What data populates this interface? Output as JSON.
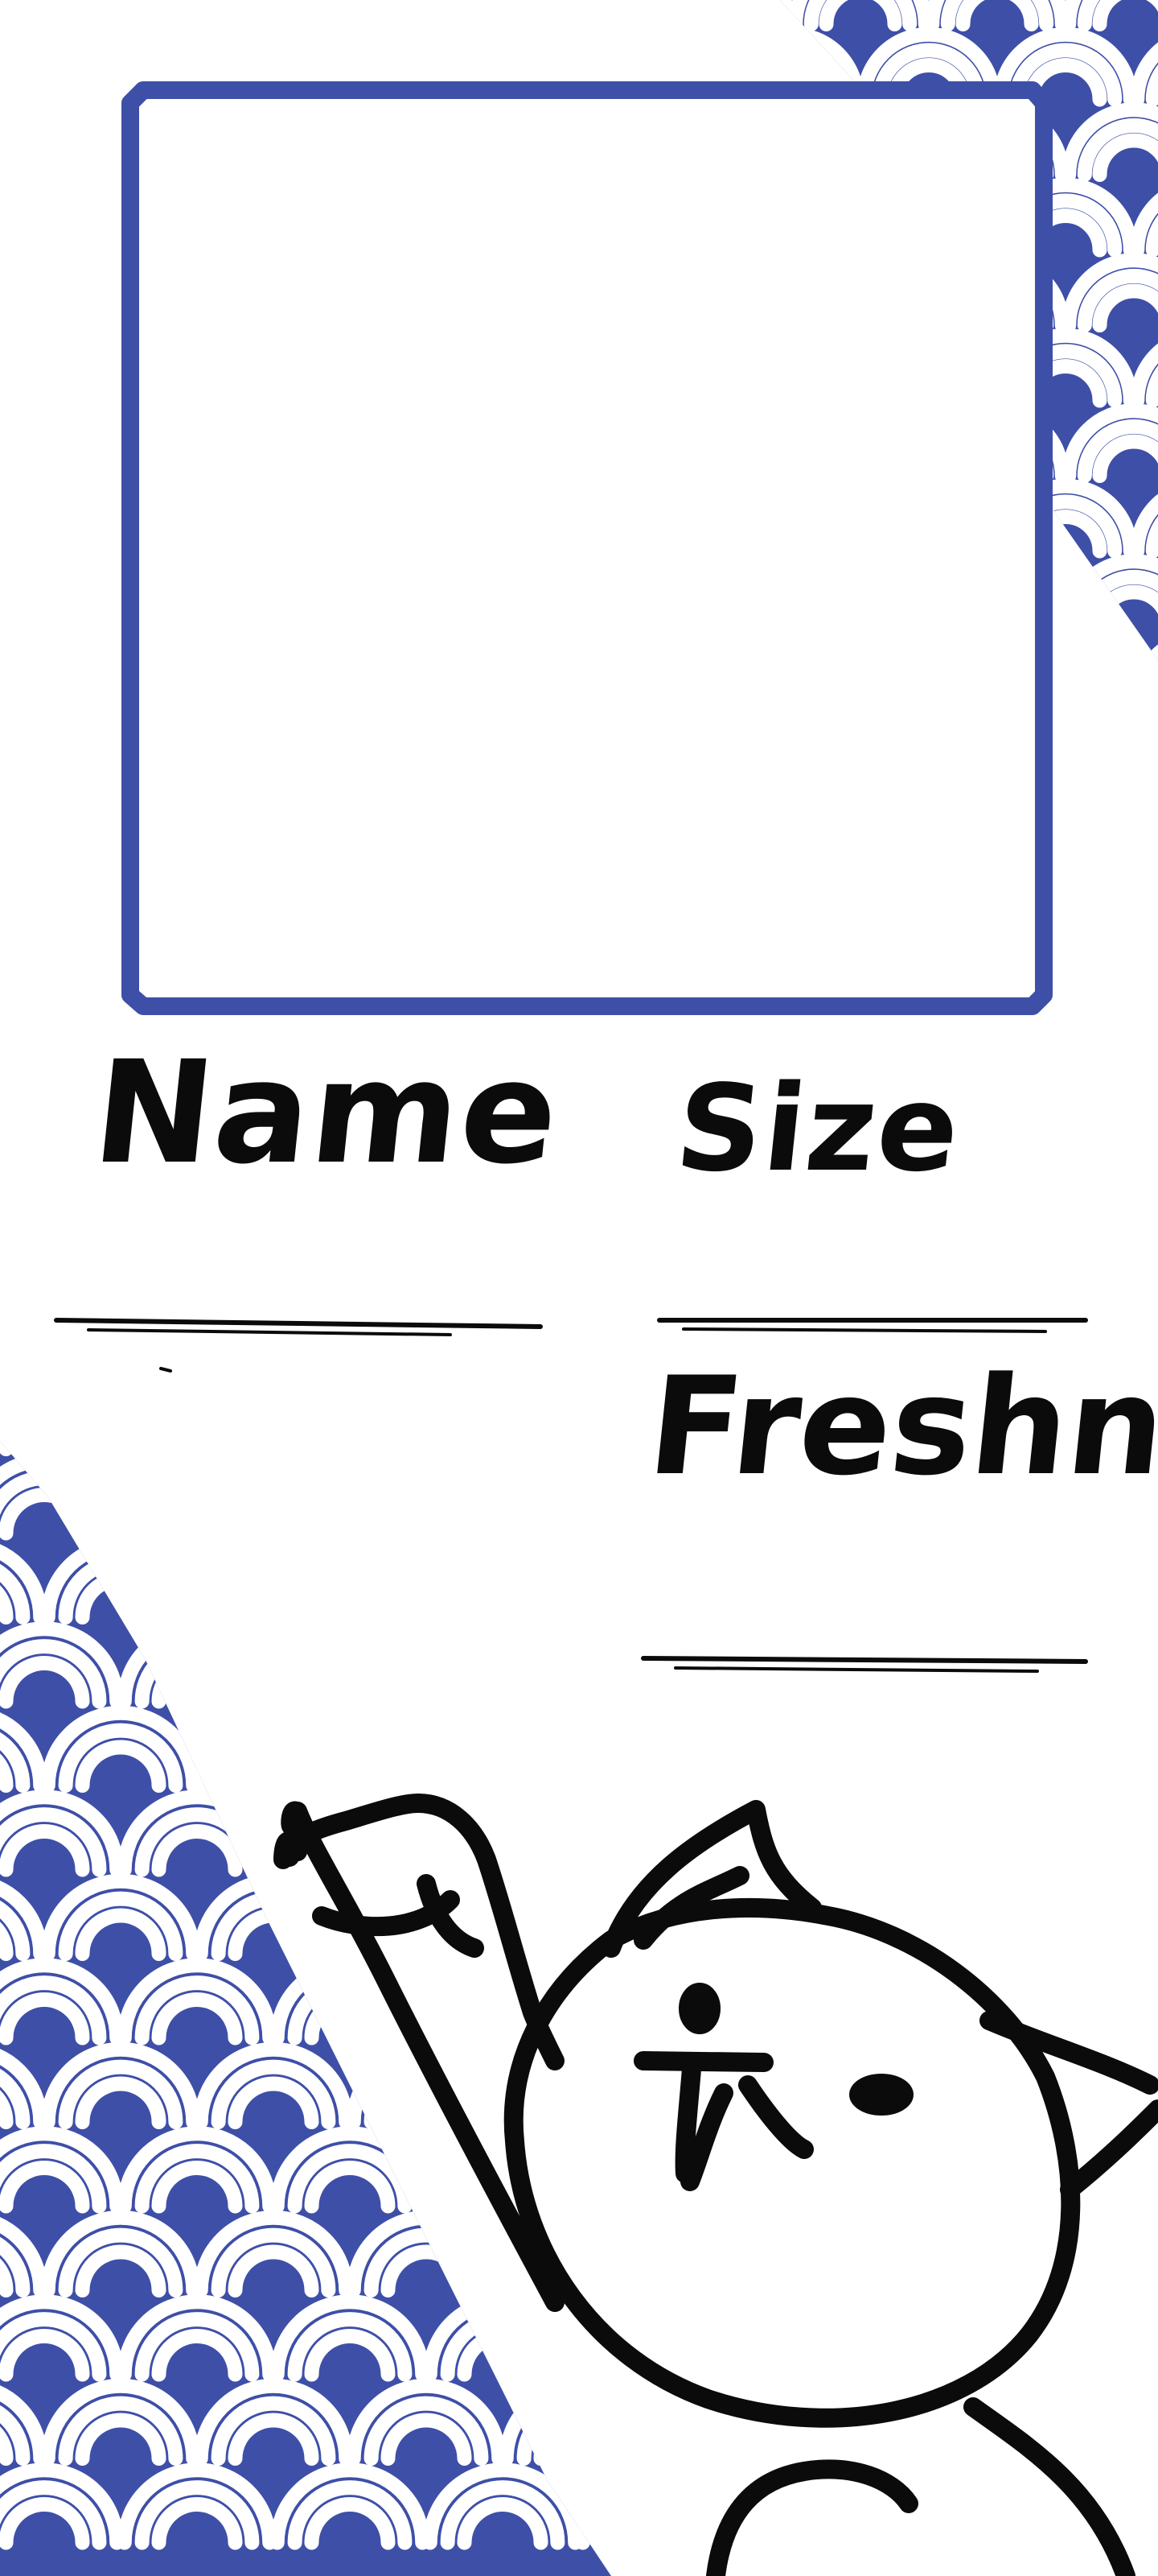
{
  "card": {
    "name_label": "Name",
    "size_label": "Size",
    "freshness_label": "Freshness"
  },
  "colors": {
    "wave_blue": "#3e4fa8",
    "wave_stroke": "#ffffff",
    "frame_blue": "#3e4fa8",
    "ink": "#0b0b0b"
  },
  "icons": [
    "wave-pattern-top-right",
    "wave-pattern-bottom-left",
    "waving-cat-drawing"
  ]
}
